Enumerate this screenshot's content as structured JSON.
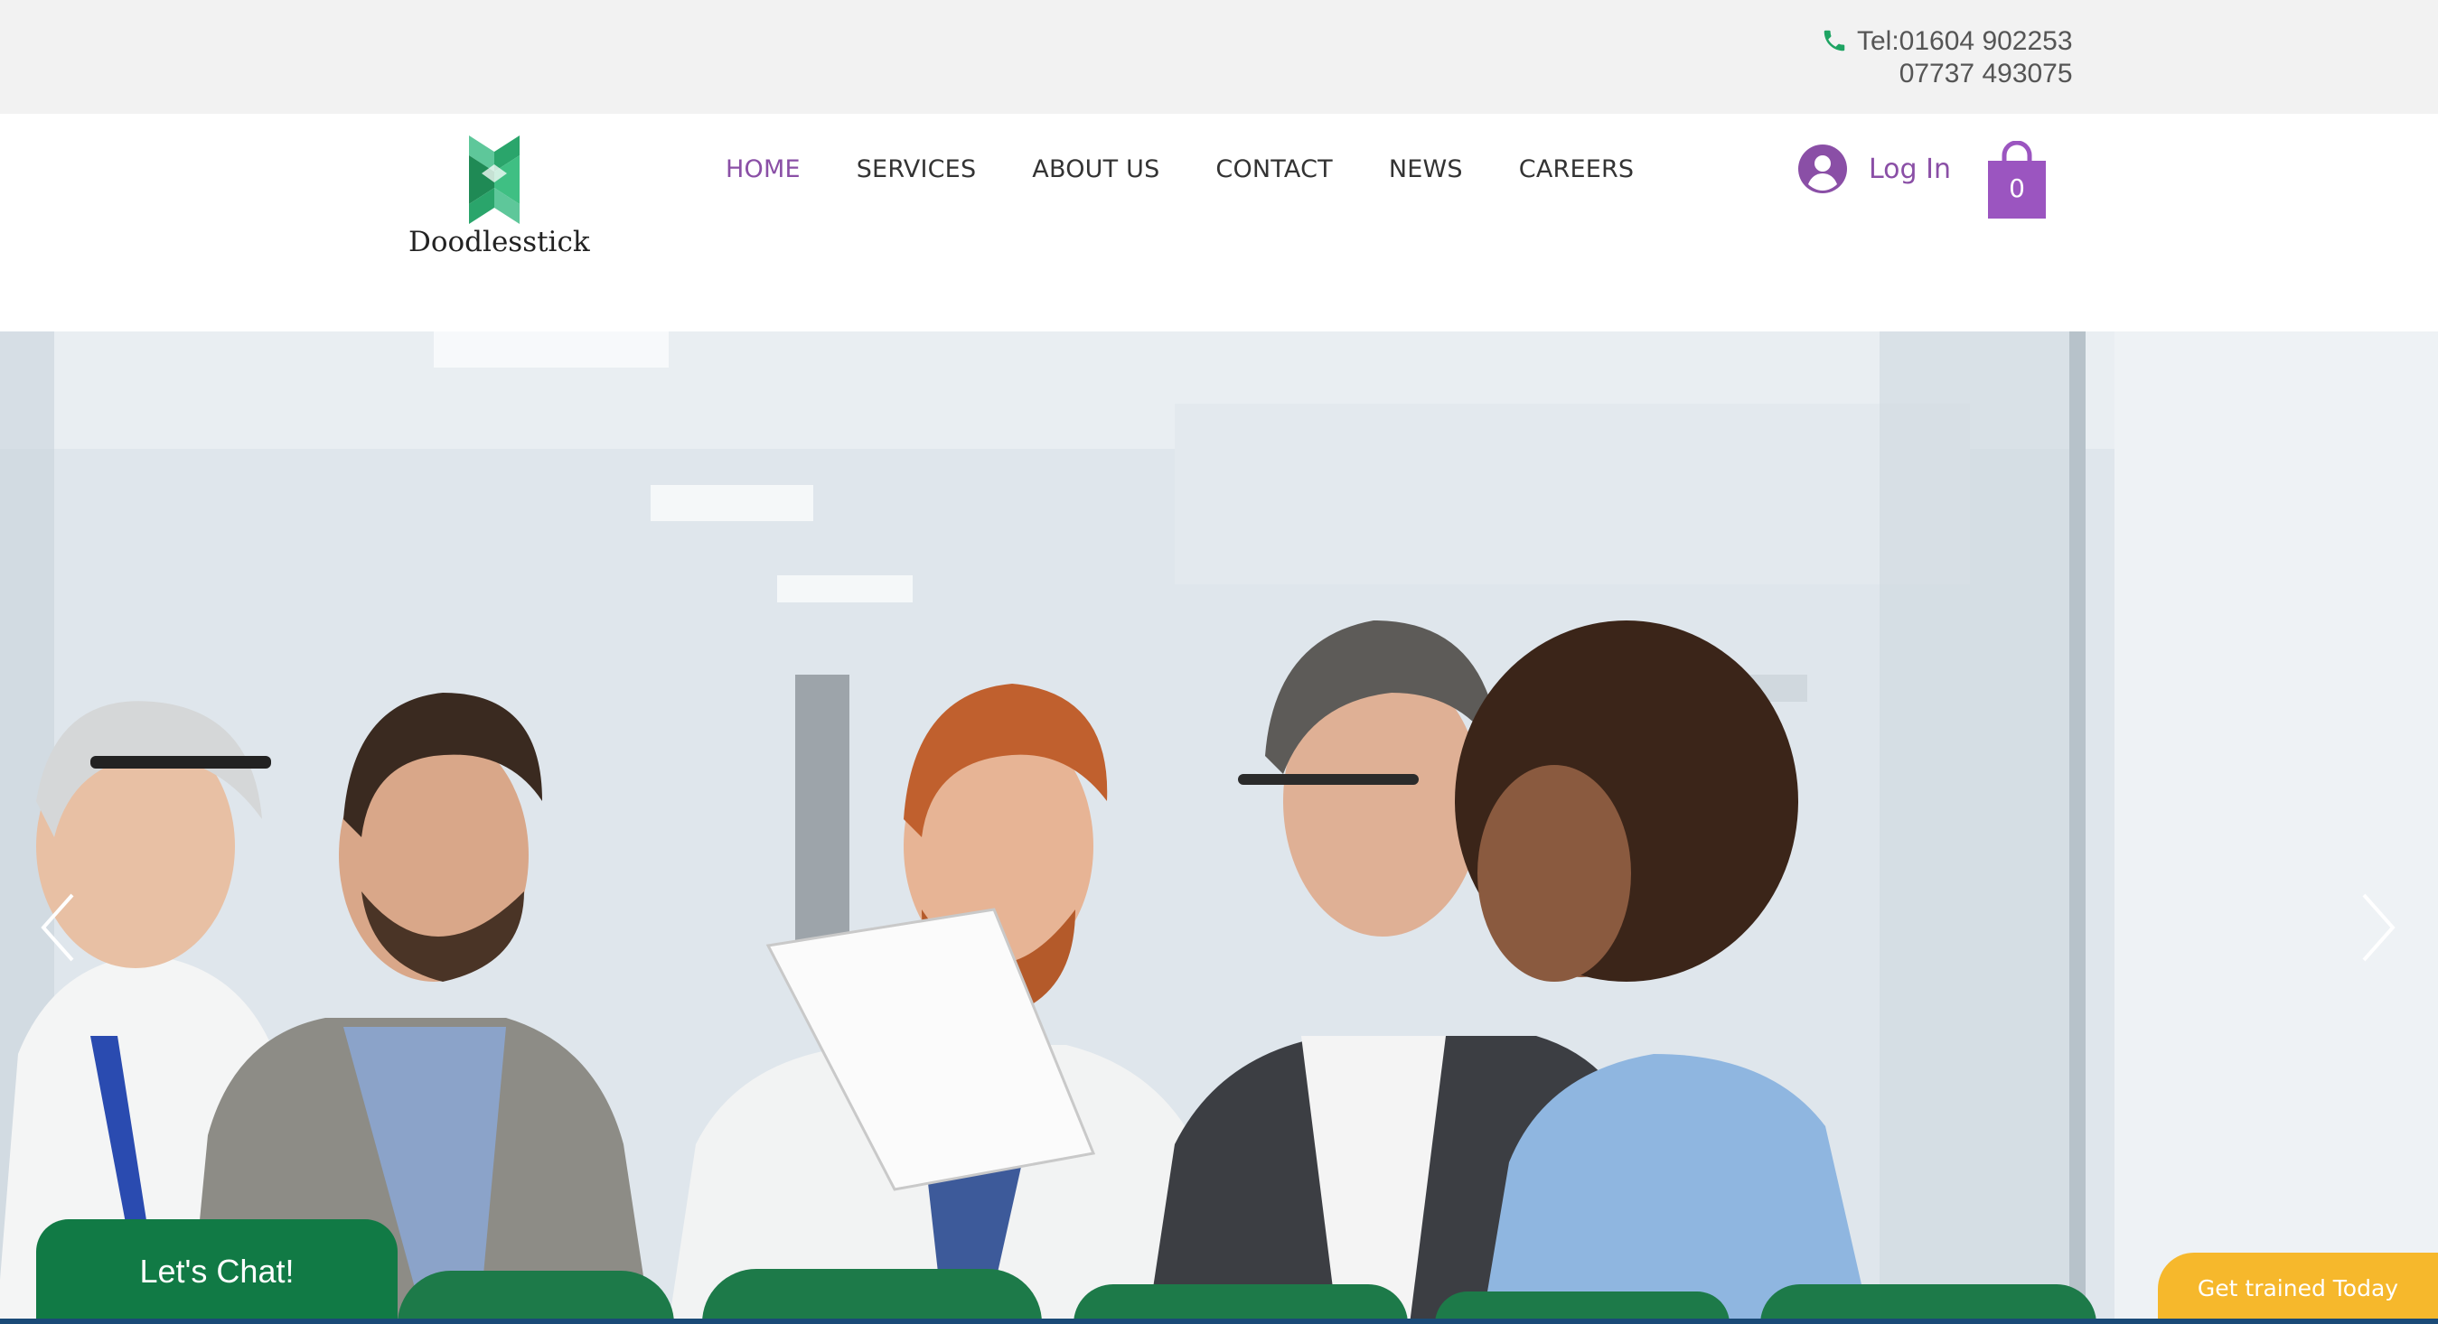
{
  "topbar": {
    "phone_icon": "phone-icon",
    "tel_line": "Tel:01604 902253",
    "mobile_line": "07737 493075"
  },
  "header": {
    "logo_text": "Doodlesstick",
    "nav": [
      {
        "label": "HOME",
        "active": true
      },
      {
        "label": "SERVICES",
        "active": false
      },
      {
        "label": "ABOUT US",
        "active": false
      },
      {
        "label": "CONTACT",
        "active": false
      },
      {
        "label": "NEWS",
        "active": false
      },
      {
        "label": "CAREERS",
        "active": false
      }
    ],
    "login_label": "Log In",
    "cart_count": "0"
  },
  "hero": {
    "prev_icon": "chevron-left-icon",
    "next_icon": "chevron-right-icon"
  },
  "widgets": {
    "chat_label": "Let's Chat!",
    "trained_label": "Get trained Today"
  },
  "colors": {
    "accent_purple": "#8a4fa6",
    "brand_green": "#117a45",
    "cta_yellow": "#f6b82c"
  }
}
